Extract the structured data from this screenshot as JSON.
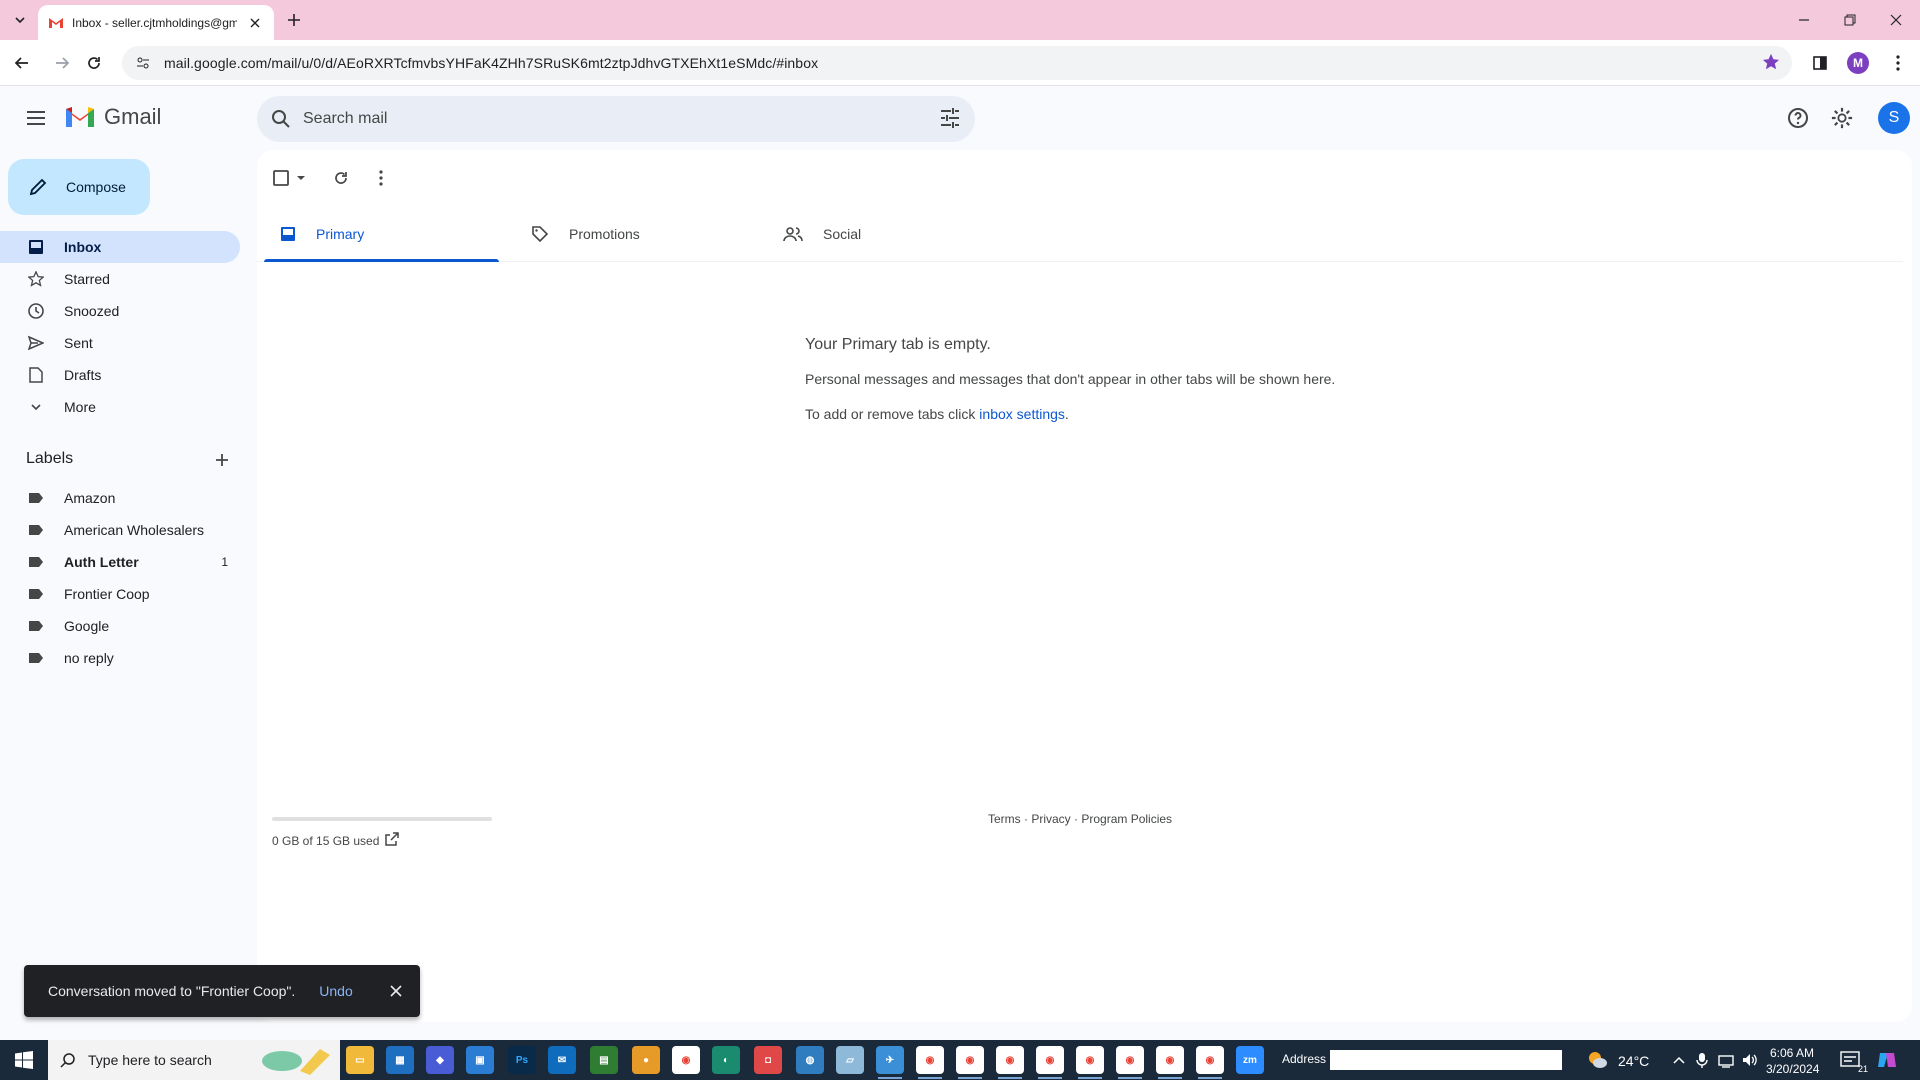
{
  "browser": {
    "tab_title": "Inbox - seller.cjtmholdings@gmail.com - Gmail",
    "url": "mail.google.com/mail/u/0/d/AEoRXRTcfmvbsYHFaK4ZHh7SRuSK6mt2ztpJdhvGTXEhXt1eSMdc/#inbox",
    "profile_initial": "M"
  },
  "gmail": {
    "logo_text": "Gmail",
    "search_placeholder": "Search mail",
    "account_initial": "S",
    "compose_label": "Compose"
  },
  "sidebar": {
    "items": [
      {
        "label": "Inbox",
        "icon": "inbox-icon",
        "active": true
      },
      {
        "label": "Starred",
        "icon": "star-icon"
      },
      {
        "label": "Snoozed",
        "icon": "clock-icon"
      },
      {
        "label": "Sent",
        "icon": "send-icon"
      },
      {
        "label": "Drafts",
        "icon": "draft-icon"
      },
      {
        "label": "More",
        "icon": "chevron-down-icon"
      }
    ],
    "labels_heading": "Labels",
    "labels": [
      {
        "label": "Amazon"
      },
      {
        "label": "American Wholesalers"
      },
      {
        "label": "Auth Letter",
        "count": "1",
        "bold": true
      },
      {
        "label": "Frontier Coop"
      },
      {
        "label": "Google"
      },
      {
        "label": "no reply"
      }
    ]
  },
  "main": {
    "tabs": [
      {
        "label": "Primary",
        "active": true
      },
      {
        "label": "Promotions"
      },
      {
        "label": "Social"
      }
    ],
    "empty_title": "Your Primary tab is empty.",
    "empty_line1": "Personal messages and messages that don't appear in other tabs will be shown here.",
    "empty_line2_prefix": "To add or remove tabs click ",
    "empty_line2_link": "inbox settings",
    "empty_line2_suffix": ".",
    "storage_text": "0 GB of 15 GB used",
    "storage_fraction": 0,
    "footer": {
      "terms": "Terms",
      "privacy": "Privacy",
      "policies": "Program Policies",
      "sep": " · "
    }
  },
  "snackbar": {
    "text": "Conversation moved to \"Frontier Coop\".",
    "undo": "Undo"
  },
  "taskbar": {
    "search_placeholder": "Type here to search",
    "address_label": "Address",
    "temperature": "24°C",
    "time": "6:06 AM",
    "date": "3/20/2024",
    "notification_count": "21"
  }
}
